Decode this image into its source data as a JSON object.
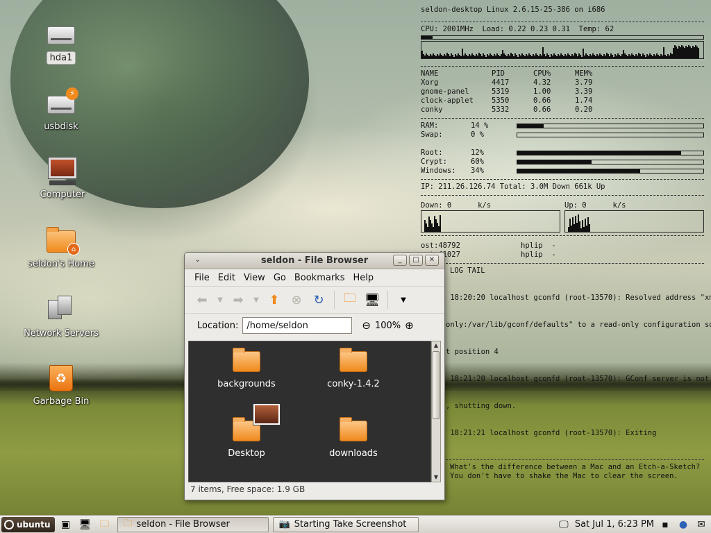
{
  "desktop": {
    "icons": [
      {
        "label": "hda1",
        "icon": "hard-drive-icon"
      },
      {
        "label": "usbdisk",
        "icon": "usb-drive-icon"
      },
      {
        "label": "Computer",
        "icon": "computer-icon"
      },
      {
        "label": "seldon's Home",
        "icon": "home-folder-icon"
      },
      {
        "label": "Network Servers",
        "icon": "network-servers-icon"
      },
      {
        "label": "Garbage Bin",
        "icon": "trash-icon"
      }
    ]
  },
  "conky": {
    "header": "seldon-desktop Linux 2.6.15-25-386 on i686",
    "cpu_line": "CPU: 2001MHz  Load: 0.22 0.23 0.31  Temp: 62",
    "processes": {
      "headers": [
        "NAME",
        "PID",
        "CPU%",
        "MEM%"
      ],
      "rows": [
        [
          "Xorg",
          "4417",
          "4.32",
          "3.79"
        ],
        [
          "gnome-panel",
          "5319",
          "1.00",
          "3.39"
        ],
        [
          "clock-applet",
          "5350",
          "0.66",
          "1.74"
        ],
        [
          "conky",
          "5332",
          "0.66",
          "0.20"
        ]
      ]
    },
    "memory": [
      {
        "label": "RAM:",
        "value": "14 %",
        "level": 0.14
      },
      {
        "label": "Swap:",
        "value": "0  %",
        "level": 0.0
      }
    ],
    "disks": [
      {
        "label": "Root:",
        "value": "12%",
        "level": 0.88
      },
      {
        "label": "Crypt:",
        "value": "60%",
        "level": 0.4
      },
      {
        "label": "Windows:",
        "value": "34%",
        "level": 0.66
      }
    ],
    "ip_line": "IP: 211.26.126.74 Total: 3.0M Down 661k Up",
    "down_label": "Down: 0      k/s",
    "up_label": "Up: 0      k/s",
    "connections": [
      [
        "ost:48792",
        "hplip  -"
      ],
      [
        "ost:41027",
        "hplip  -"
      ]
    ],
    "log_title": "LOG TAIL",
    "log_lines": [
      " 18:20:20 localhost gconfd (root-13570): Resolved address \"xm",
      "only:/var/lib/gconf/defaults\" to a read-only configuration so",
      "t position 4",
      " 18:21:20 localhost gconfd (root-13570): GConf server is not",
      ", shutting down.",
      " 18:21:21 localhost gconfd (root-13570): Exiting"
    ],
    "fortune_lines": [
      "What's the difference between a Mac and an Etch-a-Sketch?",
      "You don't have to shake the Mac to clear the screen."
    ]
  },
  "window": {
    "title": "seldon - File Browser",
    "menu": [
      "File",
      "Edit",
      "View",
      "Go",
      "Bookmarks",
      "Help"
    ],
    "location_label": "Location:",
    "location_value": "/home/seldon",
    "zoom_level": "100%",
    "files": [
      {
        "name": "backgrounds"
      },
      {
        "name": "conky-1.4.2"
      },
      {
        "name": "Desktop"
      },
      {
        "name": "downloads"
      }
    ],
    "status": "7 items, Free space: 1.9 GB",
    "scroll_position": 0.0
  },
  "taskbar": {
    "start_label": "ubuntu",
    "tasks": [
      {
        "label": "seldon - File Browser",
        "active": true
      },
      {
        "label": "Starting Take Screenshot",
        "active": false
      }
    ],
    "clock": "Sat Jul  1,  6:23 PM"
  }
}
